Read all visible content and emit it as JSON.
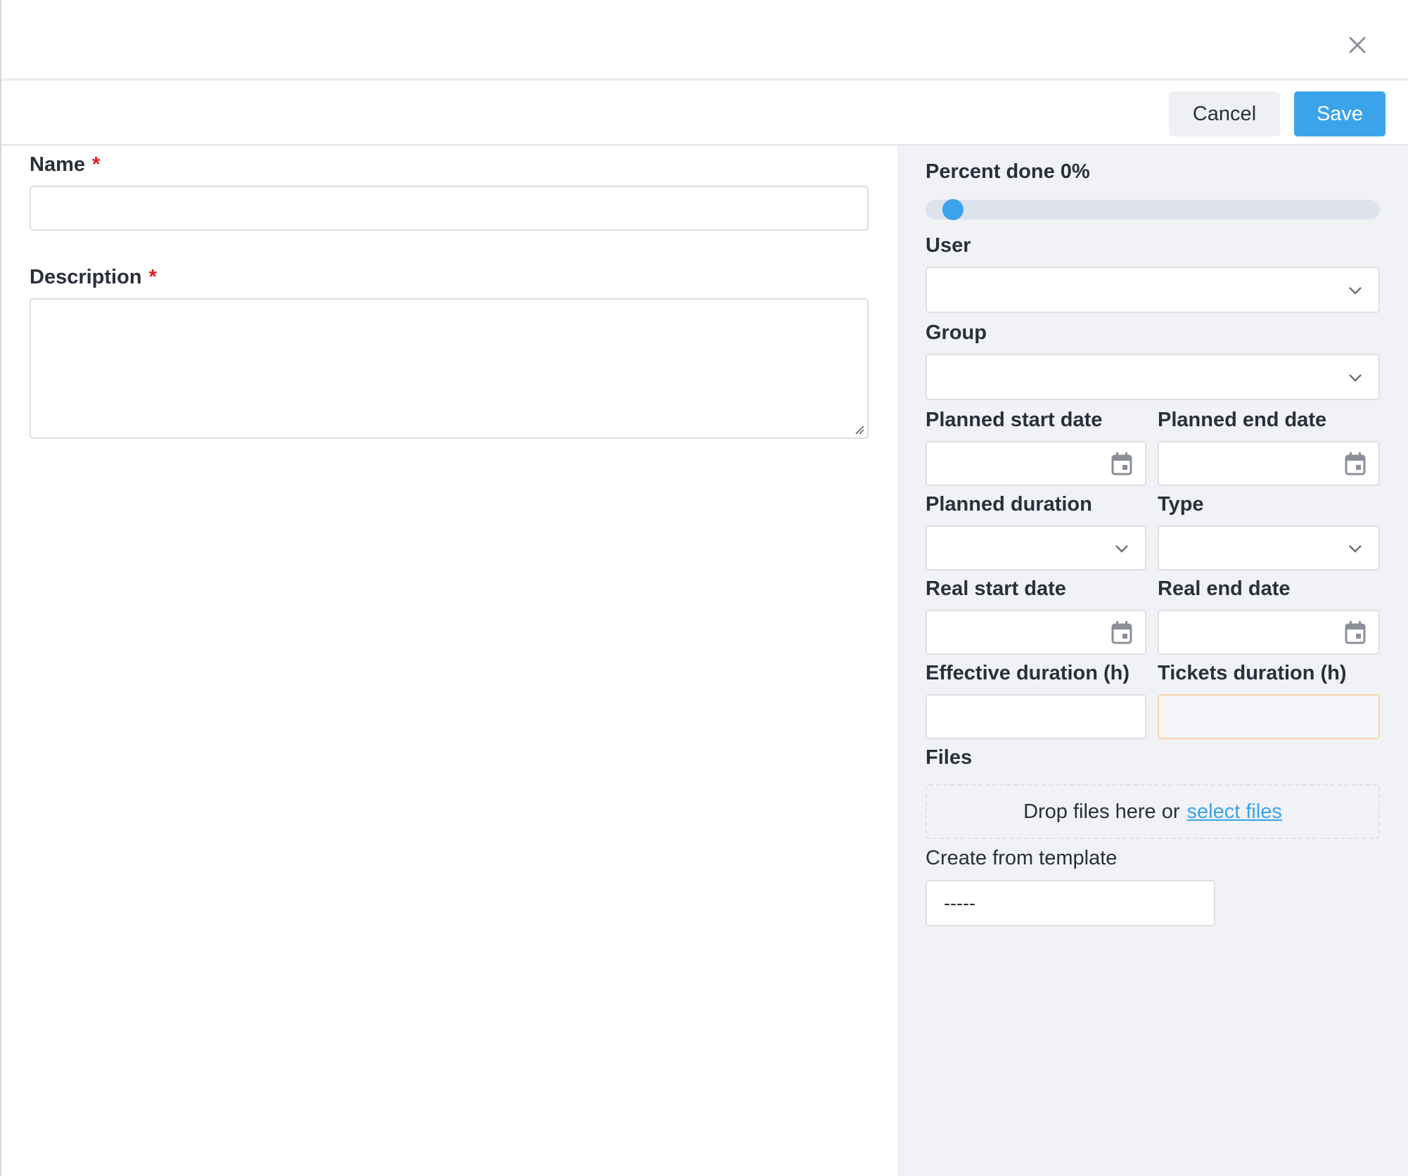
{
  "dialog": {
    "close_icon": "close-icon"
  },
  "toolbar": {
    "cancel_label": "Cancel",
    "save_label": "Save"
  },
  "form": {
    "name_label": "Name",
    "name_value": "",
    "description_label": "Description",
    "description_value": "",
    "required_marker": "*"
  },
  "sidebar": {
    "percent_done_label": "Percent done 0%",
    "percent_done_value": 0,
    "user_label": "User",
    "group_label": "Group",
    "planned_start_label": "Planned start date",
    "planned_end_label": "Planned end date",
    "planned_duration_label": "Planned duration",
    "type_label": "Type",
    "real_start_label": "Real start date",
    "real_end_label": "Real end date",
    "effective_duration_label": "Effective duration (h)",
    "tickets_duration_label": "Tickets duration (h)",
    "files_label": "Files",
    "dropzone_text": "Drop files here or",
    "dropzone_link": "select files",
    "template_label": "Create from template",
    "template_value": "-----"
  },
  "colors": {
    "accent": "#3ba3ea",
    "required": "#e01b24",
    "sidebar_bg": "#f1f2f6",
    "highlight_border": "#f5d7a8"
  }
}
